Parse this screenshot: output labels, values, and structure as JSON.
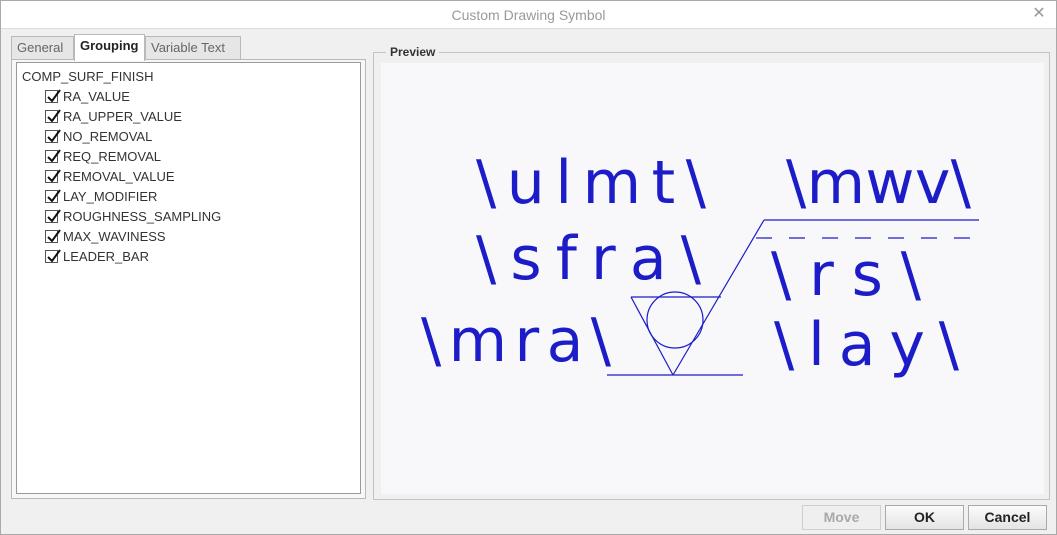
{
  "window": {
    "title": "Custom Drawing Symbol"
  },
  "tabs": [
    {
      "label": "General",
      "active": false
    },
    {
      "label": "Grouping",
      "active": true
    },
    {
      "label": "Variable Text",
      "active": false
    }
  ],
  "tree": {
    "root": "COMP_SURF_FINISH",
    "items": [
      {
        "label": "RA_VALUE",
        "checked": true
      },
      {
        "label": "RA_UPPER_VALUE",
        "checked": true
      },
      {
        "label": "NO_REMOVAL",
        "checked": true
      },
      {
        "label": "REQ_REMOVAL",
        "checked": true
      },
      {
        "label": "REMOVAL_VALUE",
        "checked": true
      },
      {
        "label": "LAY_MODIFIER",
        "checked": true
      },
      {
        "label": "ROUGHNESS_SAMPLING",
        "checked": true
      },
      {
        "label": "MAX_WAVINESS",
        "checked": true
      },
      {
        "label": "LEADER_BAR",
        "checked": true
      }
    ]
  },
  "preview": {
    "label": "Preview",
    "stroke_color": "#1c1cc8",
    "texts": {
      "ulmt": "\\ulmt\\",
      "mwv": "\\mwv\\",
      "sfra": "\\sfra\\",
      "rs": "\\rs\\",
      "mra": "\\mra\\",
      "lay": "\\lay\\"
    }
  },
  "buttons": {
    "move": "Move",
    "ok": "OK",
    "cancel": "Cancel"
  }
}
